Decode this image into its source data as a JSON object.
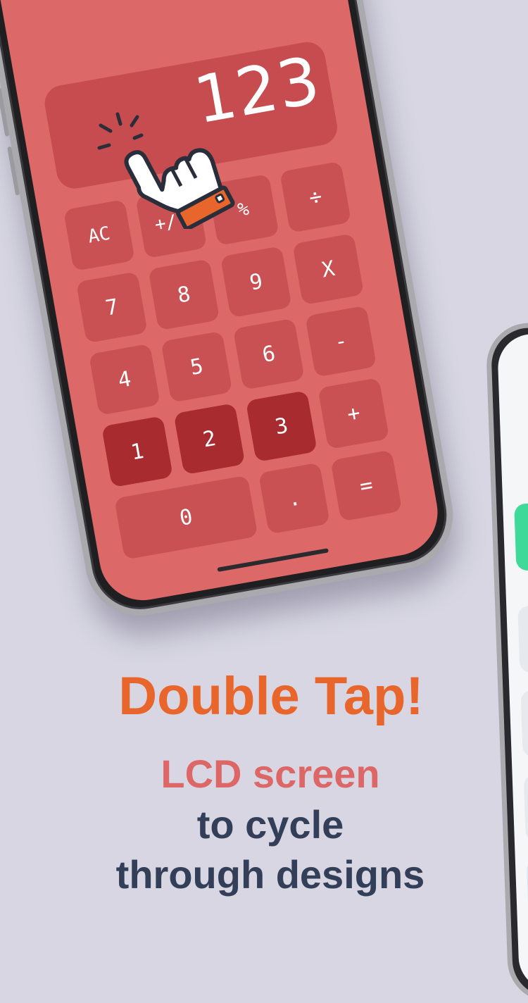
{
  "calculator": {
    "display_value": "123",
    "keys": {
      "ac": "AC",
      "sign": "+/-",
      "percent": "%",
      "divide": "÷",
      "seven": "7",
      "eight": "8",
      "nine": "9",
      "multiply": "X",
      "four": "4",
      "five": "5",
      "six": "6",
      "minus": "-",
      "one": "1",
      "two": "2",
      "three": "3",
      "plus": "+",
      "zero": "0",
      "decimal": ".",
      "equals": "="
    }
  },
  "icons": [
    "tap-hand-icon"
  ],
  "colors": {
    "background": "#d7d6e2",
    "screen": "#dc6868",
    "key": "#c95053",
    "key_pressed": "#a82b30",
    "headline": "#e8652b",
    "highlight": "#dd6767",
    "body_text": "#333e58"
  },
  "caption": {
    "headline": "Double Tap!",
    "line1": "LCD screen",
    "line2": "to cycle",
    "line3": "through designs"
  }
}
